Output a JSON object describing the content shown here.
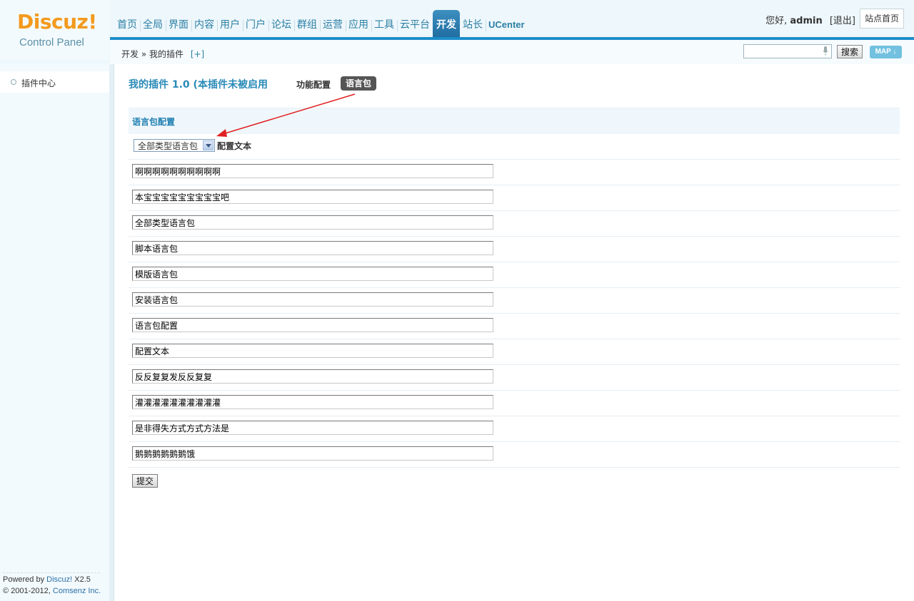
{
  "header": {
    "logo_title": "Discuz!",
    "logo_subtitle": "Control Panel",
    "nav": [
      "首页",
      "全局",
      "界面",
      "内容",
      "用户",
      "门户",
      "论坛",
      "群组",
      "运营",
      "应用",
      "工具",
      "云平台",
      "开发",
      "站长",
      "UCenter"
    ],
    "active_nav": "开发",
    "greeting": "您好,",
    "username": "admin",
    "logout": "[退出]",
    "site_home": "站点首页",
    "search_placeholder": "",
    "search_button": "搜索",
    "map_button": "MAP"
  },
  "breadcrumb": {
    "text": "开发 » 我的插件",
    "add": "[+]"
  },
  "sidebar": {
    "item": "插件中心",
    "footer_line1_prefix": "Powered by ",
    "footer_brand": "Discuz!",
    "footer_version": " X2.5",
    "footer_line2_prefix": "© 2001-2012, ",
    "footer_company": "Comsenz Inc."
  },
  "main": {
    "plugin_title": "我的插件 1.0 (本插件未被启用",
    "tab_config": "功能配置",
    "tab_lang": "语言包",
    "section_title": "语言包配置",
    "select_value": "全部类型语言包",
    "select_label": "配置文本",
    "fields": [
      "啊啊啊啊啊啊啊啊啊啊",
      "本宝宝宝宝宝宝宝宝宝吧",
      "全部类型语言包",
      "脚本语言包",
      "模版语言包",
      "安装语言包",
      "语言包配置",
      "配置文本",
      "反反复复发反反复复",
      "灌灌灌灌灌灌灌灌灌灌",
      "是非得失方式方式方法是",
      "鹅鹅鹅鹅鹅鹅饿"
    ],
    "submit": "提交"
  },
  "colors": {
    "accent": "#1d8dc9",
    "nav_text": "#2b7fa5",
    "logo": "#f39a1e",
    "annotation_arrow": "#e02020"
  }
}
